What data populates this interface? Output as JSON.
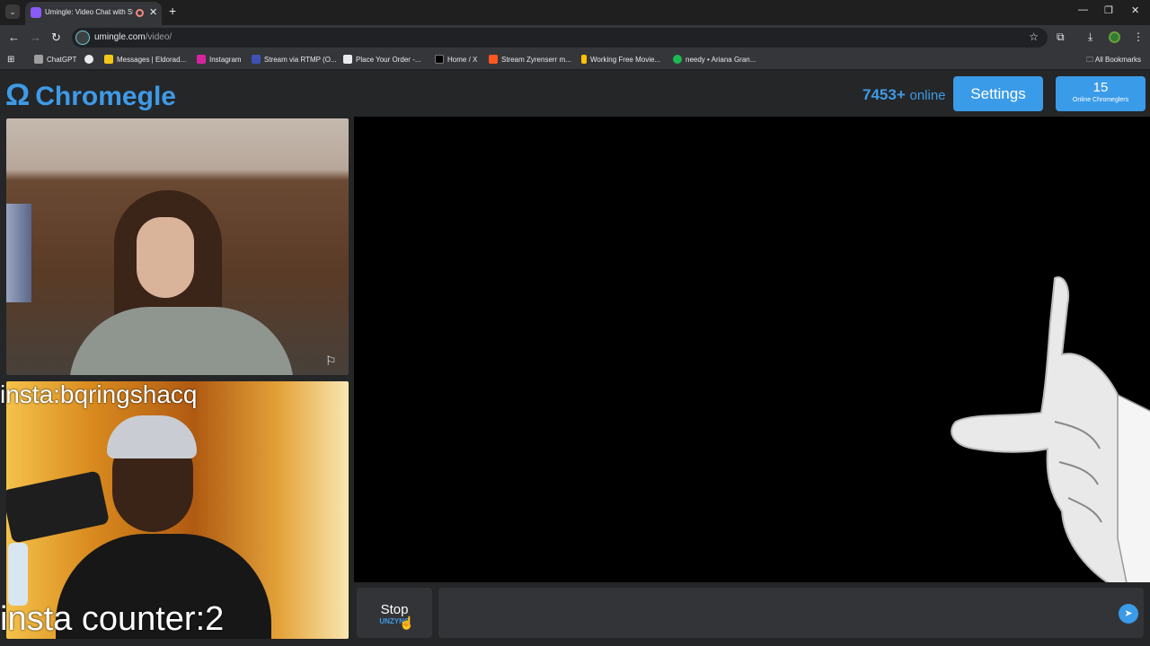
{
  "browser": {
    "tab_title": "Umingle: Video Chat with St",
    "new_tab": "+",
    "url_host": "umingle.com",
    "url_path": "/video/",
    "bookmarks": [
      {
        "label": "ChatGPT",
        "color": "#9e9e9e"
      },
      {
        "label": "",
        "color": "#e8eaed"
      },
      {
        "label": "Messages | Eldorad...",
        "color": "#f5c518"
      },
      {
        "label": "Instagram",
        "color": "#d6249f"
      },
      {
        "label": "Stream via RTMP (O...",
        "color": "#3f51b5"
      },
      {
        "label": "Place Your Order -...",
        "color": "#e8eaed"
      },
      {
        "label": "Home / X",
        "color": "#000000"
      },
      {
        "label": "Stream Zyrenserr m...",
        "color": "#ff5722"
      },
      {
        "label": "Working Free Movie...",
        "color": "#ffc107"
      },
      {
        "label": "needy • Ariana Gran...",
        "color": "#1db954"
      }
    ],
    "all_bookmarks": "All Bookmarks"
  },
  "site": {
    "logo_symbol": "Ω",
    "logo_text": "Chromegle",
    "online_count": "7453+",
    "online_label": "online",
    "settings_label": "Settings",
    "chromeglers_count": "15",
    "chromeglers_label": "Online Chromeglers",
    "overlay_top": "insta:bqringshacq",
    "overlay_bottom": "insta counter:2",
    "stop_label": "Stop",
    "stop_sub": "UNZYNC",
    "chat_placeholder": ""
  },
  "colors": {
    "accent": "#3a9be8",
    "page_bg": "#252628"
  },
  "icons": [
    "flag-icon",
    "send-icon",
    "star-icon",
    "extensions-icon",
    "download-icon",
    "more-icon"
  ]
}
